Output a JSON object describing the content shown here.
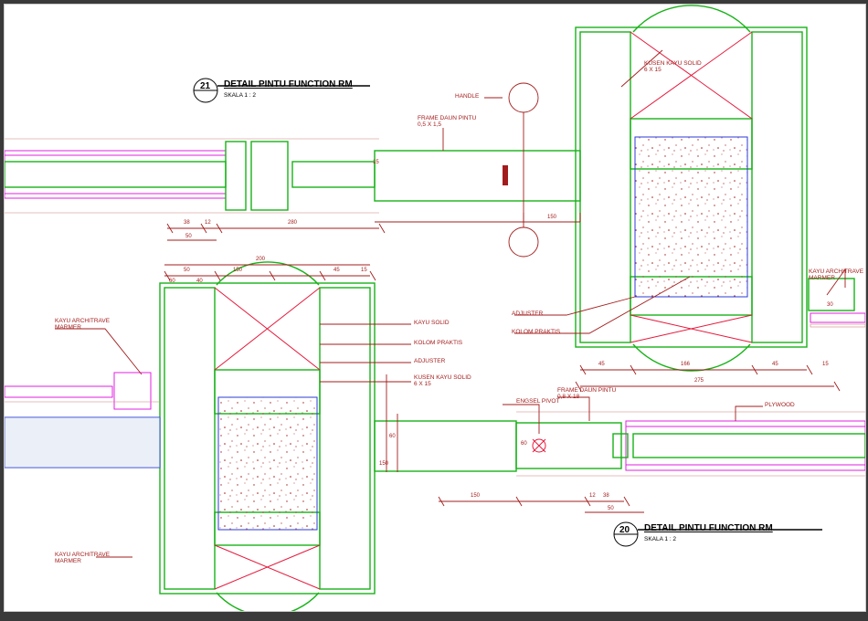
{
  "tag21": {
    "num": "21",
    "title": "DETAIL PINTU FUNCTION RM",
    "scale": "SKALA   1 : 2"
  },
  "tag20": {
    "num": "20",
    "title": "DETAIL PINTU FUNCTION RM",
    "scale": "SKALA   1 : 2"
  },
  "callouts": {
    "handle": "HANDLE",
    "kusen": "KUSEN KAYU SOLID\n6 X 15",
    "frame_daun": "FRAME DAUN PINTU\n0,5 X 1,5",
    "adjuster": "ADJUSTER",
    "kolom": "KOLOM PRAKTIS",
    "kayu_solid": "KAYU SOLID",
    "kayu_architrave": "KAYU ARCHITRAVE\nMARMER",
    "engsel": "ENGSEL PIVOT",
    "plywood": "PLYWOOD",
    "frame_daun2": "FRAME DAUN PINTU\n0,8 X 18"
  },
  "dims": {
    "d12": "12",
    "d15": "15",
    "d30": "30",
    "d38": "38",
    "d40": "40",
    "d45": "45",
    "d50": "50",
    "d60": "60",
    "d80": "80",
    "d150": "150",
    "d166": "166",
    "d200": "200",
    "d275": "275",
    "d280": "280"
  }
}
